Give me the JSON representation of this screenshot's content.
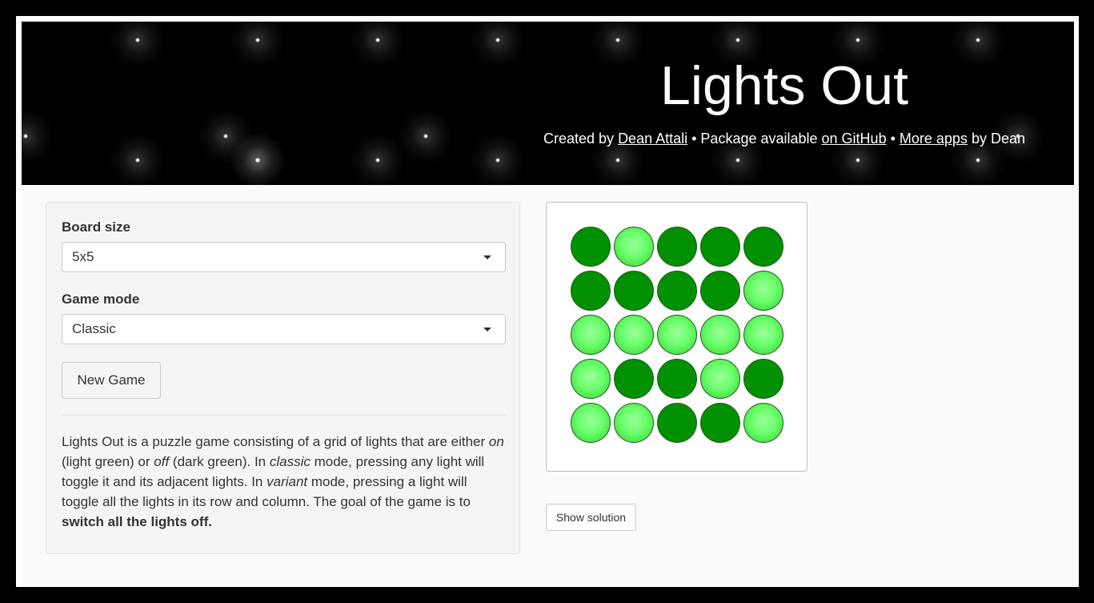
{
  "header": {
    "title": "Lights Out",
    "subtitle": {
      "created_by": "Created by ",
      "author_link": "Dean Attali",
      "sep1": " • Package available ",
      "github_link": "on GitHub",
      "sep2": " • ",
      "more_apps_link": "More apps",
      "by_dean": " by Dean"
    }
  },
  "controls": {
    "board_size_label": "Board size",
    "board_size_value": "5x5",
    "game_mode_label": "Game mode",
    "game_mode_value": "Classic",
    "new_game_label": "New Game"
  },
  "description": {
    "p1": "Lights Out is a puzzle game consisting of a grid of lights that are either ",
    "on": "on",
    "p2": " (light green) or ",
    "off": "off",
    "p3": " (dark green). In ",
    "classic": "classic",
    "p4": " mode, pressing any light will toggle it and its adjacent lights. In ",
    "variant": "variant",
    "p5": " mode, pressing a light will toggle all the lights in its row and column. The goal of the game is to ",
    "goal": "switch all the lights off."
  },
  "board": {
    "size": 5,
    "cells": [
      [
        0,
        1,
        0,
        0,
        0
      ],
      [
        0,
        0,
        0,
        0,
        1
      ],
      [
        1,
        1,
        1,
        1,
        1
      ],
      [
        1,
        0,
        0,
        1,
        0
      ],
      [
        1,
        1,
        0,
        0,
        1
      ]
    ],
    "colors": {
      "on": "#66ff66",
      "off": "#009000"
    }
  },
  "show_solution_label": "Show solution"
}
